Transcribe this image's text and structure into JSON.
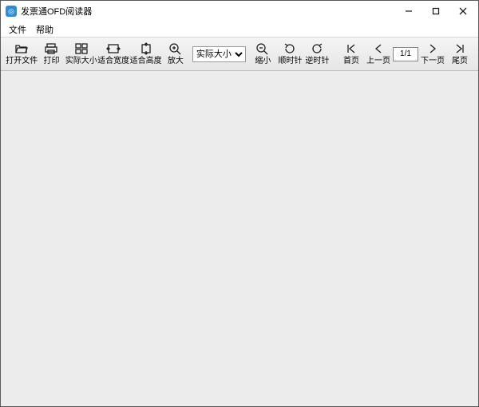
{
  "titlebar": {
    "title": "发票通OFD阅读器"
  },
  "menubar": {
    "file": "文件",
    "help": "帮助"
  },
  "toolbar": {
    "open": "打开文件",
    "print": "打印",
    "actual_size": "实际大小",
    "fit_width": "适合宽度",
    "fit_height": "适合高度",
    "zoom_in": "放大",
    "zoom_out": "缩小",
    "rotate_cw": "顺时针",
    "rotate_ccw": "逆时针",
    "first_page": "首页",
    "prev_page": "上一页",
    "next_page": "下一页",
    "last_page": "尾页",
    "zoom_select_value": "实际大小",
    "page_indicator": "1/1"
  }
}
